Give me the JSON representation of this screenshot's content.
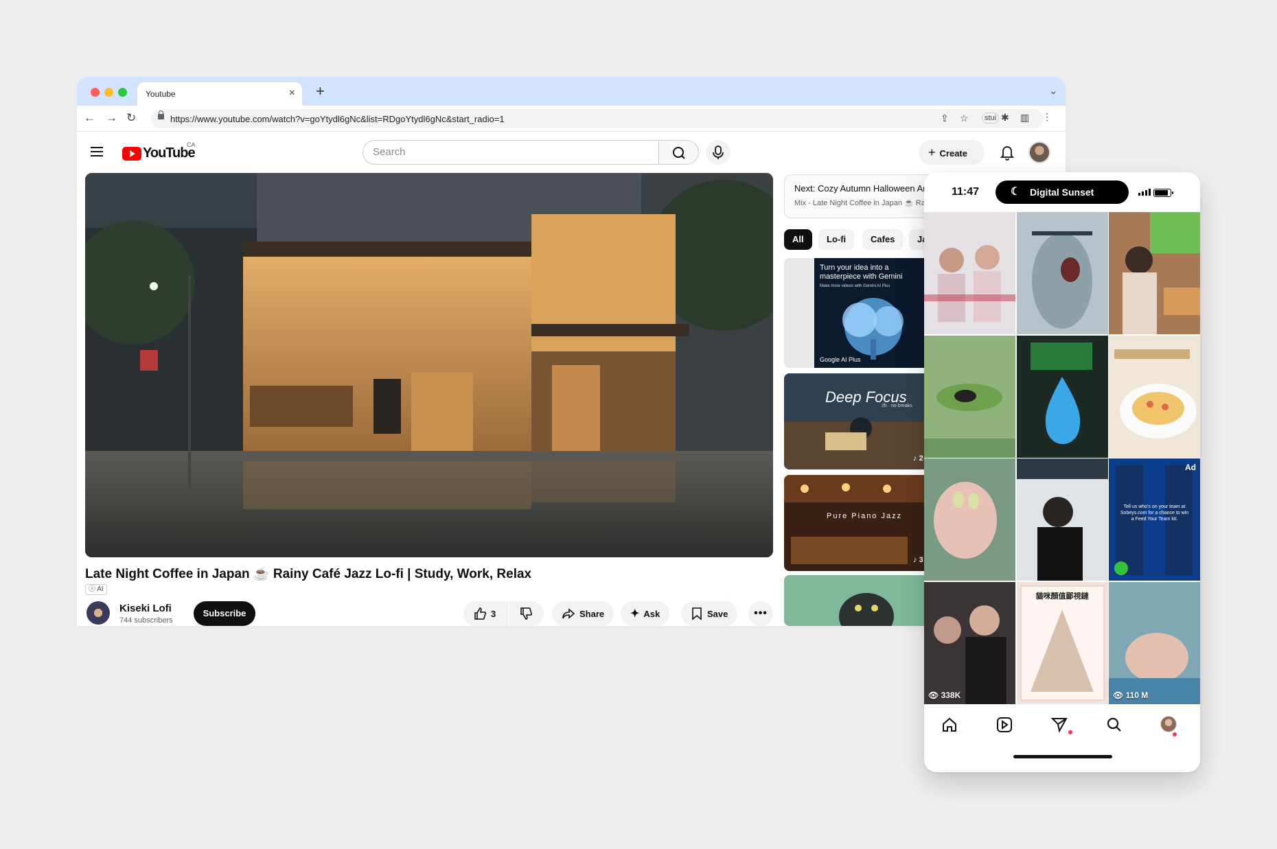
{
  "browser": {
    "tab_title": "Youtube",
    "url": "https://www.youtube.com/watch?v=goYtydl6gNc&list=RDgoYtydl6gNc&start_radio=1",
    "extension_label": "stui"
  },
  "youtube": {
    "logo_text": "YouTube",
    "region": "CA",
    "search_placeholder": "Search",
    "create_label": "Create",
    "video": {
      "title": "Late Night Coffee in Japan ☕ Rainy Café Jazz Lo-fi | Study, Work, Relax",
      "ai_badge": "AI",
      "channel_name": "Kiseki Lofi",
      "subscribers": "744 subscribers",
      "subscribe_label": "Subscribe",
      "like_count": "3",
      "share_label": "Share",
      "ask_label": "Ask",
      "save_label": "Save"
    },
    "next": {
      "title": "Next: Cozy Autumn Halloween Ambience",
      "subtitle": "Mix - Late Night Coffee in Japan ☕ Rainy Café Jazz"
    },
    "chips": [
      "All",
      "Lo-fi",
      "Cafes",
      "Jazz"
    ],
    "recommendations": {
      "ad_title": "Turn your idea into a masterpiece with Gemini",
      "ad_subtitle": "Make more videos with Gemini AI Plus",
      "ad_brand": "Google AI Plus",
      "rec1_title": "Deep Focus",
      "rec1_subtitle": "2h · no breaks",
      "rec1_badge": "2",
      "rec2_title": "Pure Piano Jazz",
      "rec2_badge": "3"
    }
  },
  "phone": {
    "time": "11:47",
    "focus_mode": "Digital Sunset",
    "cells": [
      {
        "views": ""
      },
      {
        "views": ""
      },
      {
        "views": ""
      },
      {
        "views": ""
      },
      {
        "views": ""
      },
      {
        "views": ""
      },
      {
        "views": ""
      },
      {
        "views": ""
      },
      {
        "ad": "Ad",
        "ad_text": "Tell us who's on your team at Sobeys.com for a chance to win a Feed Your Team kit."
      },
      {
        "views": "338K"
      },
      {
        "poster_title": "貓咪顏值鄙視鏈"
      },
      {
        "views": "110 M"
      }
    ]
  },
  "colors": {
    "tabstrip": "#d3e3fd",
    "youtube_red": "#ff0000",
    "chip_active": "#0f0f0f",
    "notification_dot": "#ff2d55"
  }
}
